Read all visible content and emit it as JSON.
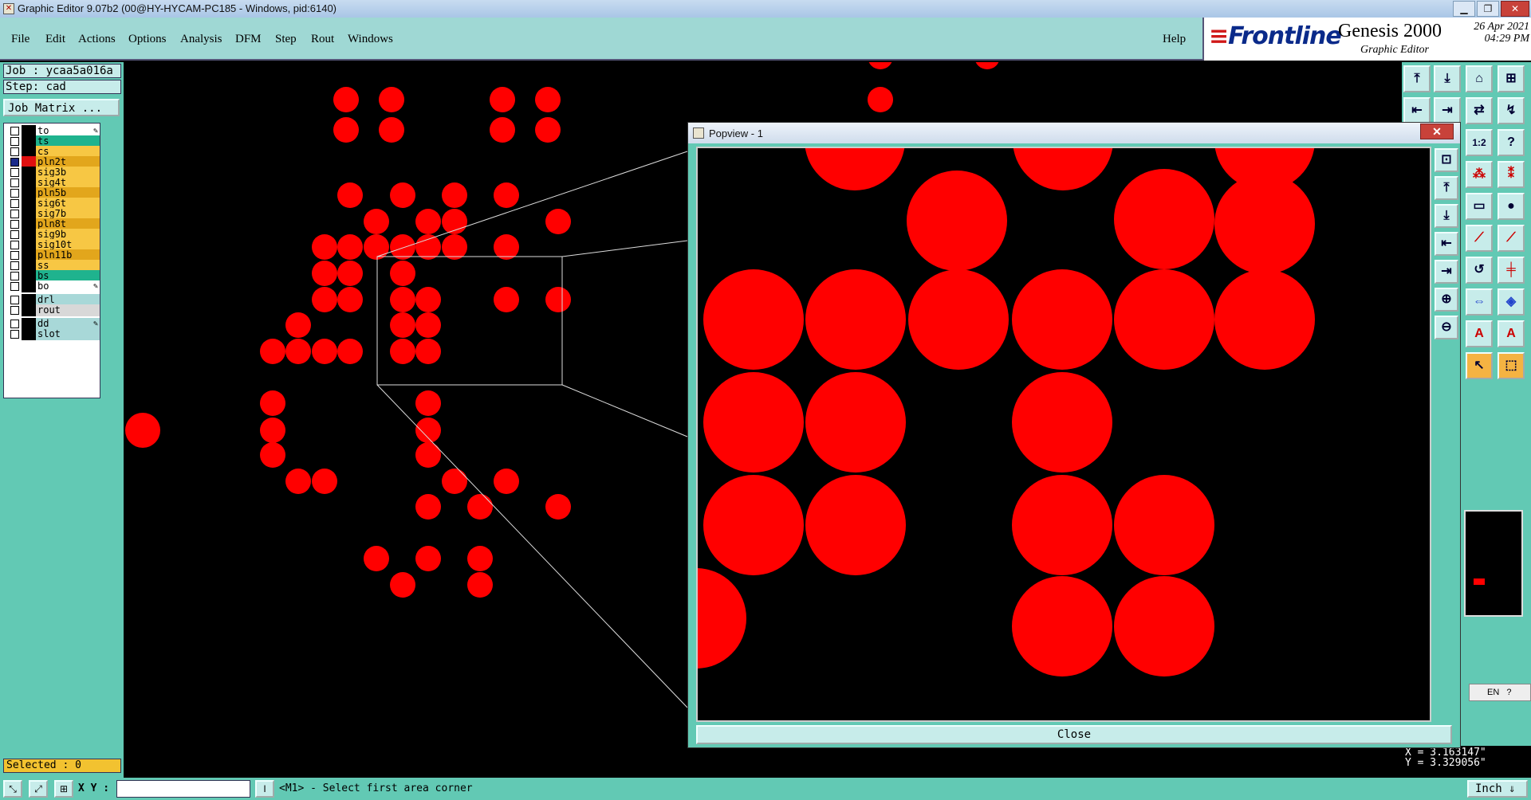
{
  "window": {
    "title": "Graphic Editor 9.07b2 (00@HY-HYCAM-PC185 - Windows, pid:6140)"
  },
  "menu": {
    "items": [
      "File",
      "Edit",
      "Actions",
      "Options",
      "Analysis",
      "DFM",
      "Step",
      "Rout",
      "Windows"
    ],
    "help": "Help"
  },
  "brand": {
    "logo": "Frontline",
    "product": "Genesis 2000",
    "subtitle": "Graphic Editor",
    "date": "26 Apr 2021",
    "time": "04:29 PM"
  },
  "job": {
    "job_label": "Job : ycaa5a016a",
    "step_label": "Step: cad",
    "matrix_button": "Job Matrix ..."
  },
  "layers": [
    {
      "name": "to",
      "color": "#ffffff",
      "checked": false,
      "editable": true
    },
    {
      "name": "ts",
      "color": "#1fb38e",
      "checked": false
    },
    {
      "name": "cs",
      "color": "#f7c744",
      "checked": false
    },
    {
      "name": "pln2t",
      "color": "#e2a61c",
      "checked": true,
      "active": true
    },
    {
      "name": "sig3b",
      "color": "#f7c744",
      "checked": false
    },
    {
      "name": "sig4t",
      "color": "#f7c744",
      "checked": false
    },
    {
      "name": "pln5b",
      "color": "#e2a61c",
      "checked": false
    },
    {
      "name": "sig6t",
      "color": "#f7c744",
      "checked": false
    },
    {
      "name": "sig7b",
      "color": "#f7c744",
      "checked": false
    },
    {
      "name": "pln8t",
      "color": "#e2a61c",
      "checked": false
    },
    {
      "name": "sig9b",
      "color": "#f7c744",
      "checked": false
    },
    {
      "name": "sig10t",
      "color": "#f7c744",
      "checked": false
    },
    {
      "name": "pln11b",
      "color": "#e2a61c",
      "checked": false
    },
    {
      "name": "ss",
      "color": "#f7c744",
      "checked": false
    },
    {
      "name": "bs",
      "color": "#1fb38e",
      "checked": false
    },
    {
      "name": "bo",
      "color": "#ffffff",
      "checked": false,
      "editable": true
    },
    {
      "name": "drl",
      "color": "#a8d8d8",
      "checked": false
    },
    {
      "name": "rout",
      "color": "#d8d8d8",
      "checked": false
    },
    {
      "name": "dd",
      "color": "#a8d8d8",
      "checked": false,
      "editable": true
    },
    {
      "name": "slot",
      "color": "#a8d8d8",
      "checked": false
    }
  ],
  "status": {
    "selected": "Selected : 0",
    "xy_label": "X Y :",
    "xy_value": "",
    "message": "<M1> - Select first area corner",
    "units": "Inch"
  },
  "coords": {
    "x": "X = 3.163147\"",
    "y": "Y = 3.329056\""
  },
  "popview": {
    "title": "Popview - 1",
    "close_label": "Close"
  },
  "ime": {
    "lang": "EN"
  },
  "colors": {
    "pad": "#ff0000",
    "panel": "#62c9b4",
    "menubar": "#9fd8d4"
  }
}
